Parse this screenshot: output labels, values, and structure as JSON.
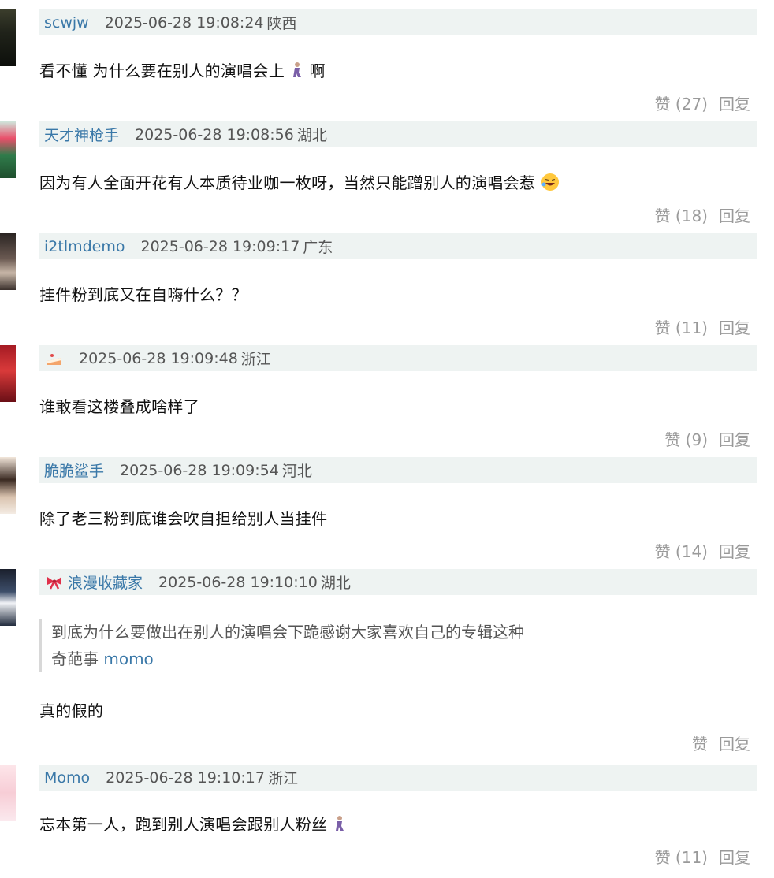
{
  "comments": [
    {
      "user": "scwjw",
      "time": "2025-06-28 19:08:24",
      "region": "陕西",
      "text": "看不懂 为什么要在别人的演唱会上",
      "tail": "啊",
      "like": "赞 (27)",
      "reply": "回复"
    },
    {
      "user": "天才神枪手",
      "time": "2025-06-28 19:08:56",
      "region": "湖北",
      "text": "因为有人全面开花有人本质待业咖一枚呀，当然只能蹭别人的演唱会惹",
      "like": "赞 (18)",
      "reply": "回复"
    },
    {
      "user": "i2tlmdemo",
      "time": "2025-06-28 19:09:17",
      "region": "广东",
      "text": "挂件粉到底又在自嗨什么？？",
      "like": "赞 (11)",
      "reply": "回复"
    },
    {
      "user": "",
      "time": "2025-06-28 19:09:48",
      "region": "浙江",
      "text": "谁敢看这楼叠成啥样了",
      "like": "赞 (9)",
      "reply": "回复"
    },
    {
      "user": "脆脆鲨手",
      "time": "2025-06-28 19:09:54",
      "region": "河北",
      "text": "除了老三粉到底谁会吹自担给别人当挂件",
      "like": "赞 (14)",
      "reply": "回复"
    },
    {
      "user": "浪漫收藏家",
      "time": "2025-06-28 19:10:10",
      "region": "湖北",
      "quote_line1": "到底为什么要做出在别人的演唱会下跪感谢大家喜欢自己的专辑这种",
      "quote_line2": "奇葩事",
      "quote_mention": "momo",
      "text": "真的假的",
      "like": "赞",
      "reply": "回复"
    },
    {
      "user": "Momo",
      "time": "2025-06-28 19:10:17",
      "region": "浙江",
      "text": "忘本第一人，跑到别人演唱会跟别人粉丝",
      "like": "赞 (11)",
      "reply": "回复"
    }
  ]
}
